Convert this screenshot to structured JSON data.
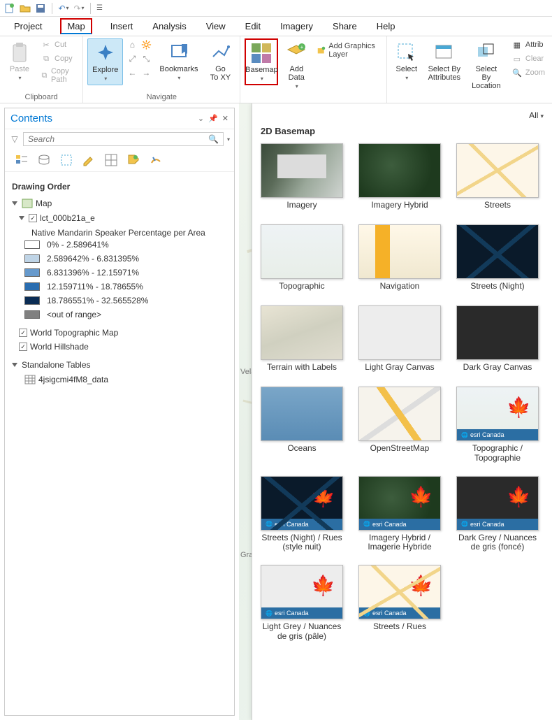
{
  "qat": {
    "items": [
      "new",
      "open",
      "save",
      "undo",
      "redo"
    ]
  },
  "menu": {
    "tabs": [
      "Project",
      "Map",
      "Insert",
      "Analysis",
      "View",
      "Edit",
      "Imagery",
      "Share",
      "Help"
    ],
    "active": "Map",
    "highlighted": "Map"
  },
  "ribbon": {
    "clipboard": {
      "label": "Clipboard",
      "paste": "Paste",
      "cut": "Cut",
      "copy": "Copy",
      "copy_path": "Copy Path"
    },
    "navigate": {
      "label": "Navigate",
      "explore": "Explore",
      "bookmarks": "Bookmarks",
      "gotoxy": "Go\nTo XY"
    },
    "layer": {
      "basemap": "Basemap",
      "add_data": "Add\nData",
      "add_graphics": "Add Graphics Layer"
    },
    "selection": {
      "select": "Select",
      "by_attr": "Select By\nAttributes",
      "by_loc": "Select By\nLocation",
      "attributes": "Attrib",
      "clear": "Clear",
      "zoom": "Zoom"
    }
  },
  "contents": {
    "title": "Contents",
    "search_placeholder": "Search",
    "drawing_order": "Drawing Order",
    "map_name": "Map",
    "layer_name": "lct_000b21a_e",
    "legend_title": "Native Mandarin Speaker Percentage per Area",
    "legend": [
      {
        "color": "#ffffff",
        "label": "0% - 2.589641%"
      },
      {
        "color": "#bfd4e6",
        "label": "2.589642% - 6.831395%"
      },
      {
        "color": "#6699cc",
        "label": "6.831396% - 12.15971%"
      },
      {
        "color": "#2a6db0",
        "label": "12.159711% - 18.78655%"
      },
      {
        "color": "#0b2c54",
        "label": "18.786551% - 32.565528%"
      }
    ],
    "out_of_range": "<out of range>",
    "out_of_range_color": "#808080",
    "basemap_layers": [
      "World Topographic Map",
      "World Hillshade"
    ],
    "standalone": "Standalone Tables",
    "table_name": "4jsigcmi4fM8_data"
  },
  "map": {
    "labels": [
      "Vela",
      "Gra"
    ]
  },
  "gallery": {
    "all": "All",
    "section": "2D Basemap",
    "items": [
      {
        "name": "Imagery",
        "style": "t-imagery"
      },
      {
        "name": "Imagery Hybrid",
        "style": "t-imghybrid"
      },
      {
        "name": "Streets",
        "style": "t-streets"
      },
      {
        "name": "Topographic",
        "style": "t-topo"
      },
      {
        "name": "Navigation",
        "style": "t-nav"
      },
      {
        "name": "Streets (Night)",
        "style": "t-night"
      },
      {
        "name": "Terrain with Labels",
        "style": "t-terrain"
      },
      {
        "name": "Light Gray Canvas",
        "style": "t-lightgray"
      },
      {
        "name": "Dark Gray Canvas",
        "style": "t-darkgray"
      },
      {
        "name": "Oceans",
        "style": "t-oceans"
      },
      {
        "name": "OpenStreetMap",
        "style": "t-osm"
      },
      {
        "name": "Topographic / Topographie",
        "style": "t-topo",
        "banner": "esri Canada",
        "leaf": true
      },
      {
        "name": "Streets (Night) / Rues (style nuit)",
        "style": "t-night",
        "banner": "esri Canada",
        "leaf": true
      },
      {
        "name": "Imagery Hybrid / Imagerie Hybride",
        "style": "t-imghybrid",
        "banner": "esri Canada",
        "leaf": true
      },
      {
        "name": "Dark Grey / Nuances de gris (foncé)",
        "style": "t-darkgray",
        "banner": "esri Canada",
        "leaf": true
      },
      {
        "name": "Light Grey / Nuances de gris (pâle)",
        "style": "t-lightgray",
        "banner": "esri Canada",
        "leaf": true
      },
      {
        "name": "Streets / Rues",
        "style": "t-streets",
        "banner": "esri Canada",
        "leaf": true
      }
    ]
  }
}
